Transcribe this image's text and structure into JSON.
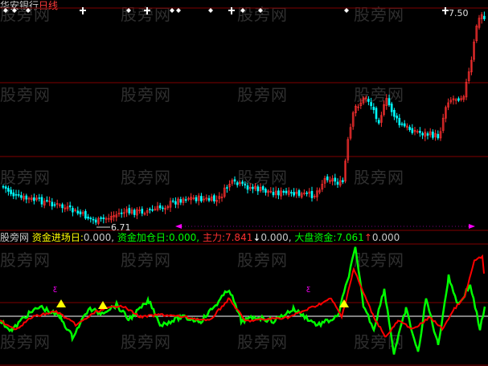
{
  "chart_title": {
    "stock_name": "华安银行",
    "period": "日线"
  },
  "price_labels": {
    "high": "7.50",
    "low": "6.71"
  },
  "indicator_bar": {
    "source": "股旁网",
    "items": [
      {
        "label": "资金进场日:",
        "value": "0.000,",
        "color": "#ffff00"
      },
      {
        "label": "资金加仓日:",
        "value": "0.000,",
        "color": "#00ff00"
      },
      {
        "label": "主力:",
        "value": "7.841",
        "arrow": "↓",
        "value2": "0.000,",
        "color": "#ff3030"
      },
      {
        "label": "大盘资金:",
        "value": "7.061",
        "arrow": "↑",
        "value2": "0.000",
        "color": "#00ff00"
      }
    ]
  },
  "watermark": "股旁网",
  "colors": {
    "up": "#ff3030",
    "down": "#00ffff",
    "main_line": "#ff0000",
    "fund_line": "#00ff00",
    "grid": "#800000",
    "baseline": "#ffffff",
    "marker": "#ffff00",
    "range_marker": "#ff00ff"
  },
  "icons": {
    "top_markers": "diamond-and-cross-icons",
    "buy_marker": "yellow-triangle-icon"
  }
}
